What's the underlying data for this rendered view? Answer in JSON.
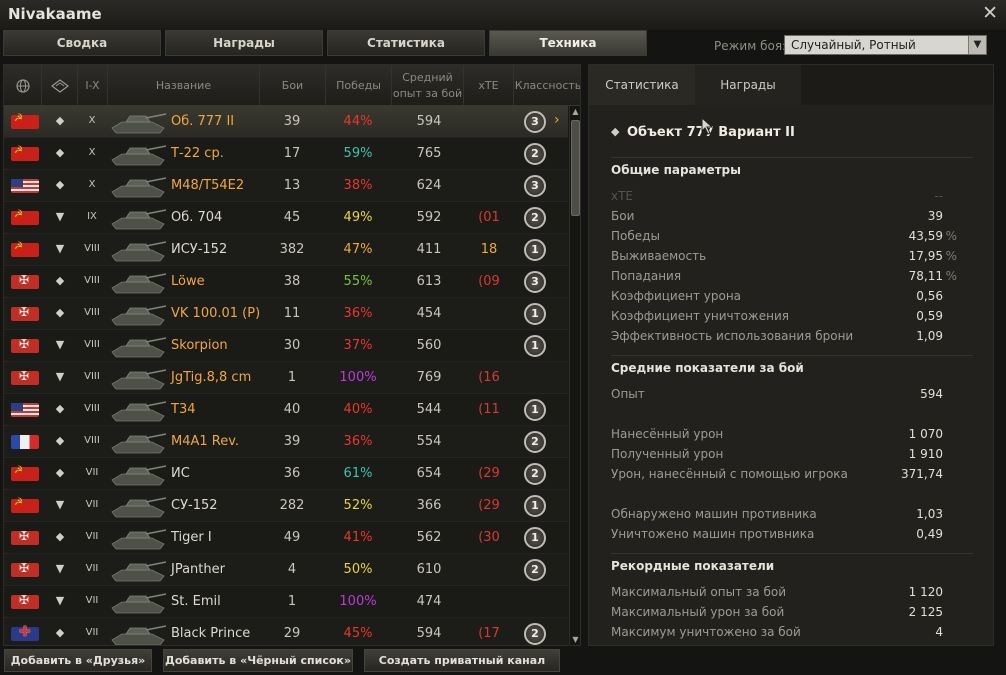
{
  "window": {
    "title": "Nivakaame",
    "close_glyph": "✕"
  },
  "tabs": [
    "Сводка",
    "Награды",
    "Статистика",
    "Техника"
  ],
  "active_tab": "Техника",
  "battle_mode": {
    "label": "Режим боя:",
    "value": "Случайный, Ротный"
  },
  "table": {
    "columns": [
      "",
      "",
      "I-X",
      "Название",
      "Бои",
      "Победы",
      "Средний опыт за бой",
      "xTE",
      "Классность"
    ],
    "rows": [
      {
        "nation": "ussr",
        "type_icon": "heavy-tank",
        "tier": "X",
        "name": "Об. 777 II",
        "gold": true,
        "battles": "39",
        "wins": "44%",
        "win_color": "#e8372a",
        "exp": "594",
        "xte": "",
        "xte_color": "#d83a2c",
        "mastery": "3",
        "selected": true
      },
      {
        "nation": "ussr",
        "type_icon": "medium-tank",
        "tier": "X",
        "name": "Т-22 ср.",
        "gold": true,
        "battles": "17",
        "wins": "59%",
        "win_color": "#3fc1b0",
        "exp": "765",
        "xte": "",
        "xte_color": "#d83a2c",
        "mastery": "2",
        "selected": false
      },
      {
        "nation": "usa",
        "type_icon": "medium-tank",
        "tier": "X",
        "name": "M48/T54E2",
        "gold": true,
        "battles": "13",
        "wins": "38%",
        "win_color": "#e8372a",
        "exp": "624",
        "xte": "",
        "xte_color": "#d83a2c",
        "mastery": "3",
        "selected": false
      },
      {
        "nation": "ussr",
        "type_icon": "td",
        "tier": "IX",
        "name": "Об. 704",
        "gold": false,
        "battles": "45",
        "wins": "49%",
        "win_color": "#e6d63a",
        "exp": "592",
        "xte": "(01",
        "xte_color": "#d83a2c",
        "mastery": "2",
        "selected": false
      },
      {
        "nation": "ussr",
        "type_icon": "td",
        "tier": "VIII",
        "name": "ИСУ-152",
        "gold": false,
        "battles": "382",
        "wins": "47%",
        "win_color": "#f0a83c",
        "exp": "411",
        "xte": "18",
        "xte_color": "#f0a83c",
        "mastery": "1",
        "selected": false
      },
      {
        "nation": "ger",
        "type_icon": "heavy-tank",
        "tier": "VIII",
        "name": "Löwe",
        "gold": true,
        "battles": "38",
        "wins": "55%",
        "win_color": "#7bc33a",
        "exp": "613",
        "xte": "(09",
        "xte_color": "#d83a2c",
        "mastery": "3",
        "selected": false
      },
      {
        "nation": "ger",
        "type_icon": "heavy-tank",
        "tier": "VIII",
        "name": "VK 100.01 (P)",
        "gold": true,
        "battles": "11",
        "wins": "36%",
        "win_color": "#e8372a",
        "exp": "454",
        "xte": "",
        "xte_color": "#d83a2c",
        "mastery": "1",
        "selected": false
      },
      {
        "nation": "ger",
        "type_icon": "td",
        "tier": "VIII",
        "name": "Skorpion",
        "gold": true,
        "battles": "30",
        "wins": "37%",
        "win_color": "#e8372a",
        "exp": "560",
        "xte": "",
        "xte_color": "#d83a2c",
        "mastery": "1",
        "selected": false
      },
      {
        "nation": "ger",
        "type_icon": "td",
        "tier": "VIII",
        "name": "JgTig.8,8 cm",
        "gold": true,
        "battles": "1",
        "wins": "100%",
        "win_color": "#c13ad8",
        "exp": "769",
        "xte": "(16",
        "xte_color": "#d83a2c",
        "mastery": "",
        "selected": false
      },
      {
        "nation": "usa",
        "type_icon": "medium-tank",
        "tier": "VIII",
        "name": "T34",
        "gold": true,
        "battles": "40",
        "wins": "40%",
        "win_color": "#e8372a",
        "exp": "544",
        "xte": "(11",
        "xte_color": "#d83a2c",
        "mastery": "1",
        "selected": false
      },
      {
        "nation": "fra",
        "type_icon": "heavy-tank",
        "tier": "VIII",
        "name": "M4A1 Rev.",
        "gold": true,
        "battles": "39",
        "wins": "36%",
        "win_color": "#e8372a",
        "exp": "554",
        "xte": "",
        "xte_color": "#d83a2c",
        "mastery": "2",
        "selected": false
      },
      {
        "nation": "ussr",
        "type_icon": "heavy-tank",
        "tier": "VII",
        "name": "ИС",
        "gold": false,
        "battles": "36",
        "wins": "61%",
        "win_color": "#3fc1b0",
        "exp": "654",
        "xte": "(29",
        "xte_color": "#d83a2c",
        "mastery": "2",
        "selected": false
      },
      {
        "nation": "ussr",
        "type_icon": "td",
        "tier": "VII",
        "name": "СУ-152",
        "gold": false,
        "battles": "282",
        "wins": "52%",
        "win_color": "#e6d63a",
        "exp": "366",
        "xte": "(29",
        "xte_color": "#d83a2c",
        "mastery": "1",
        "selected": false
      },
      {
        "nation": "ger",
        "type_icon": "heavy-tank",
        "tier": "VII",
        "name": "Tiger I",
        "gold": false,
        "battles": "49",
        "wins": "41%",
        "win_color": "#e8372a",
        "exp": "562",
        "xte": "(30",
        "xte_color": "#d83a2c",
        "mastery": "1",
        "selected": false
      },
      {
        "nation": "ger",
        "type_icon": "td",
        "tier": "VII",
        "name": "JPanther",
        "gold": false,
        "battles": "4",
        "wins": "50%",
        "win_color": "#e6d63a",
        "exp": "610",
        "xte": "",
        "xte_color": "#d83a2c",
        "mastery": "2",
        "selected": false
      },
      {
        "nation": "ger",
        "type_icon": "td",
        "tier": "VII",
        "name": "St. Emil",
        "gold": false,
        "battles": "1",
        "wins": "100%",
        "win_color": "#c13ad8",
        "exp": "474",
        "xte": "",
        "xte_color": "#d83a2c",
        "mastery": "",
        "selected": false
      },
      {
        "nation": "uk",
        "type_icon": "heavy-tank",
        "tier": "VII",
        "name": "Black Prince",
        "gold": false,
        "battles": "29",
        "wins": "45%",
        "win_color": "#e8372a",
        "exp": "594",
        "xte": "(17",
        "xte_color": "#d83a2c",
        "mastery": "2",
        "selected": false
      }
    ]
  },
  "right_panel": {
    "tabs": [
      "Статистика",
      "Награды"
    ],
    "vehicle_title": "Объект 777 Вариант II",
    "sections": [
      {
        "title": "Общие параметры",
        "rows": [
          {
            "label": "xTE",
            "value": "--",
            "unit": "",
            "dim": true
          },
          {
            "label": "Бои",
            "value": "39",
            "unit": ""
          },
          {
            "label": "Победы",
            "value": "43,59",
            "unit": "%"
          },
          {
            "label": "Выживаемость",
            "value": "17,95",
            "unit": "%"
          },
          {
            "label": "Попадания",
            "value": "78,11",
            "unit": "%"
          },
          {
            "label": "Коэффициент урона",
            "value": "0,56",
            "unit": ""
          },
          {
            "label": "Коэффициент уничтожения",
            "value": "0,59",
            "unit": ""
          },
          {
            "label": "Эффективность использования брони",
            "value": "1,09",
            "unit": ""
          }
        ]
      },
      {
        "title": "Средние показатели за бой",
        "rows": [
          {
            "label": "Опыт",
            "value": "594",
            "unit": ""
          },
          {
            "label": "Нанесённый урон",
            "value": "1 070",
            "unit": ""
          },
          {
            "label": "Полученный урон",
            "value": "1 910",
            "unit": ""
          },
          {
            "label": "Урон, нанесённый с помощью игрока",
            "value": "371,74",
            "unit": ""
          },
          {
            "label": "Обнаружено машин противника",
            "value": "1,03",
            "unit": ""
          },
          {
            "label": "Уничтожено машин противника",
            "value": "0,49",
            "unit": ""
          }
        ]
      },
      {
        "title": "Рекордные показатели",
        "rows": [
          {
            "label": "Максимальный опыт за бой",
            "value": "1 120",
            "unit": ""
          },
          {
            "label": "Максимальный урон за бой",
            "value": "2 125",
            "unit": ""
          },
          {
            "label": "Максимум уничтожено за бой",
            "value": "4",
            "unit": ""
          }
        ]
      }
    ]
  },
  "bottom_buttons": [
    "Добавить в «Друзья»",
    "Добавить в «Чёрный список»",
    "Создать приватный канал"
  ]
}
